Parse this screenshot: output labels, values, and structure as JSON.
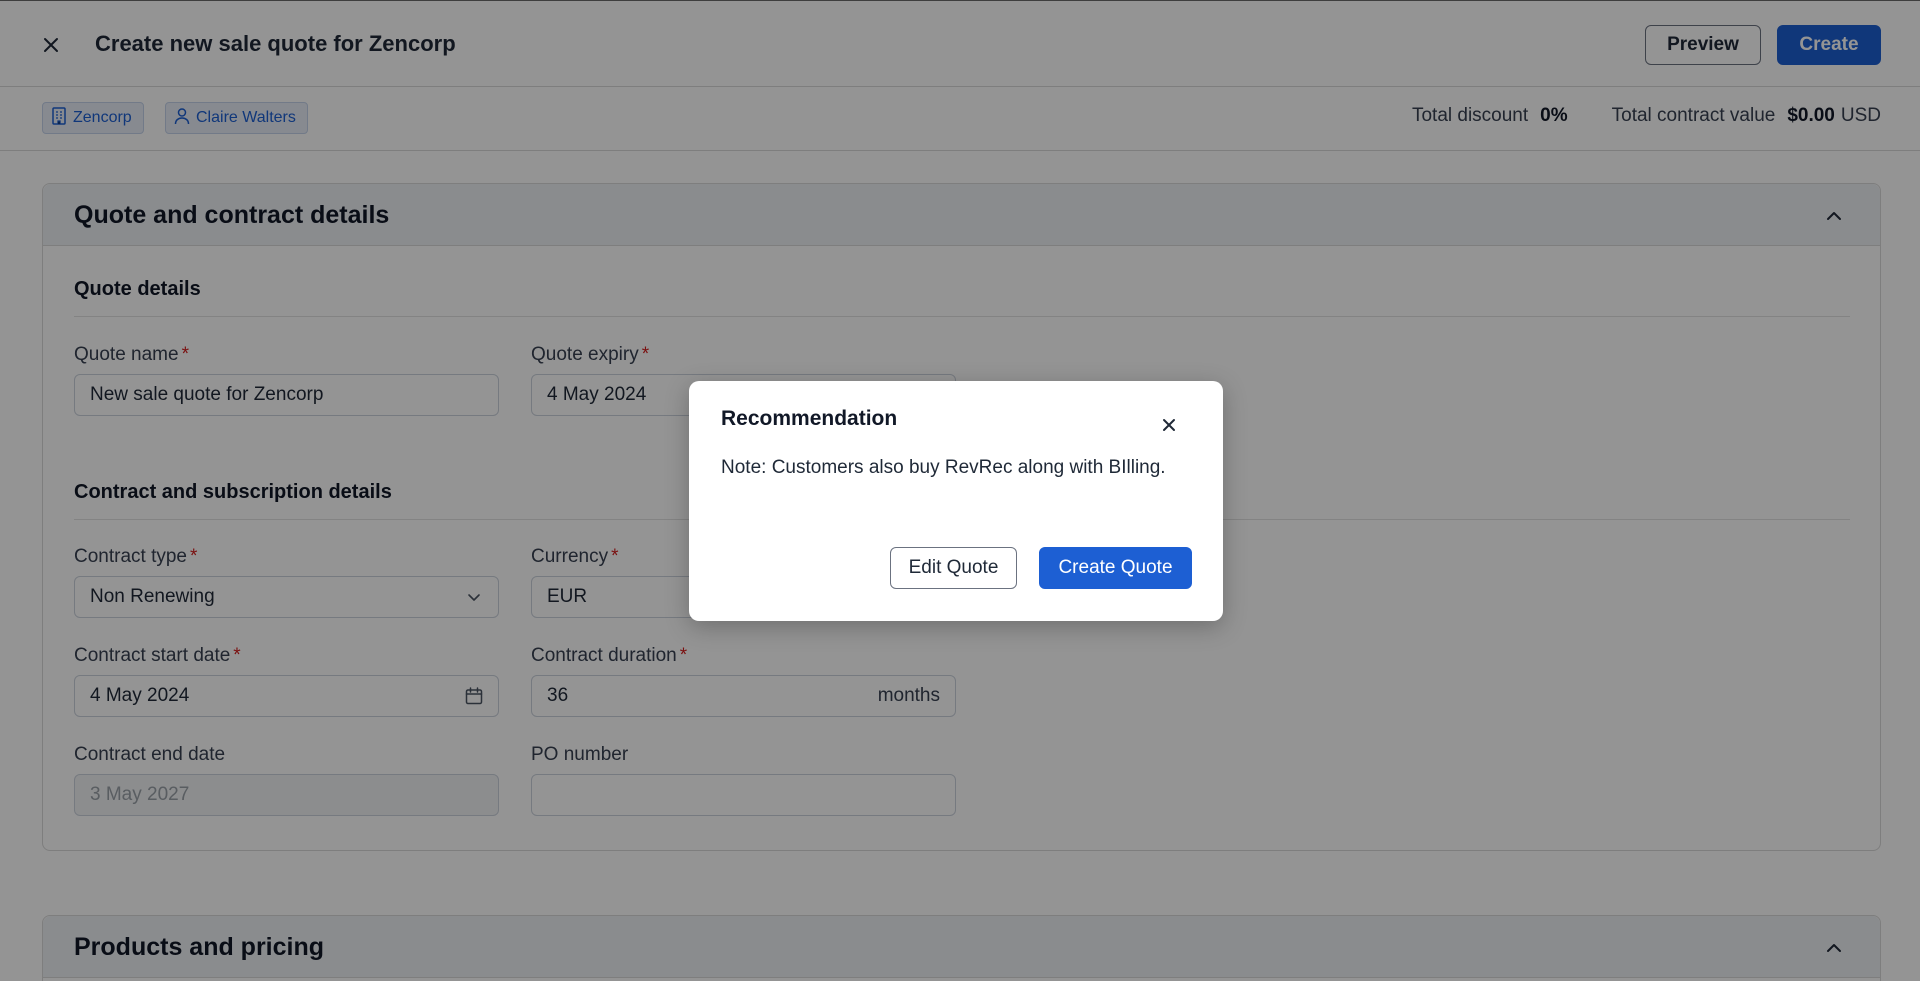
{
  "header": {
    "title": "Create new sale quote for Zencorp",
    "preview_label": "Preview",
    "create_label": "Create"
  },
  "subbar": {
    "company_chip": "Zencorp",
    "contact_chip": "Claire Walters",
    "total_discount_label": "Total discount",
    "total_discount_value": "0%",
    "total_contract_value_label": "Total contract value",
    "total_contract_value": "$0.00",
    "currency": "USD"
  },
  "quote_section": {
    "title": "Quote and contract details",
    "quote_details_heading": "Quote details",
    "quote_name_label": "Quote name",
    "quote_name_value": "New sale quote for Zencorp",
    "quote_expiry_label": "Quote expiry",
    "quote_expiry_value": "4 May 2024",
    "contract_heading": "Contract and subscription details",
    "contract_type_label": "Contract type",
    "contract_type_value": "Non Renewing",
    "currency_label": "Currency",
    "currency_value": "EUR",
    "start_date_label": "Contract start date",
    "start_date_value": "4 May 2024",
    "duration_label": "Contract duration",
    "duration_value": "36",
    "duration_unit": "months",
    "end_date_label": "Contract end date",
    "end_date_value": "3 May 2027",
    "po_label": "PO number",
    "po_value": "",
    "required_mark": "*"
  },
  "products_section": {
    "title": "Products and pricing"
  },
  "modal": {
    "title": "Recommendation",
    "message": "Note: Customers also buy RevRec along with BIlling.",
    "edit_label": "Edit Quote",
    "create_label": "Create Quote"
  },
  "icons": {
    "close": "close-icon",
    "building": "building-icon",
    "person": "person-icon",
    "chevron_up": "chevron-up-icon",
    "chevron_down": "chevron-down-icon",
    "calendar": "calendar-icon"
  },
  "colors": {
    "primary": "#1d5fd3",
    "required": "#d41e1e",
    "overlay": "rgba(0,0,0,0.42)"
  }
}
